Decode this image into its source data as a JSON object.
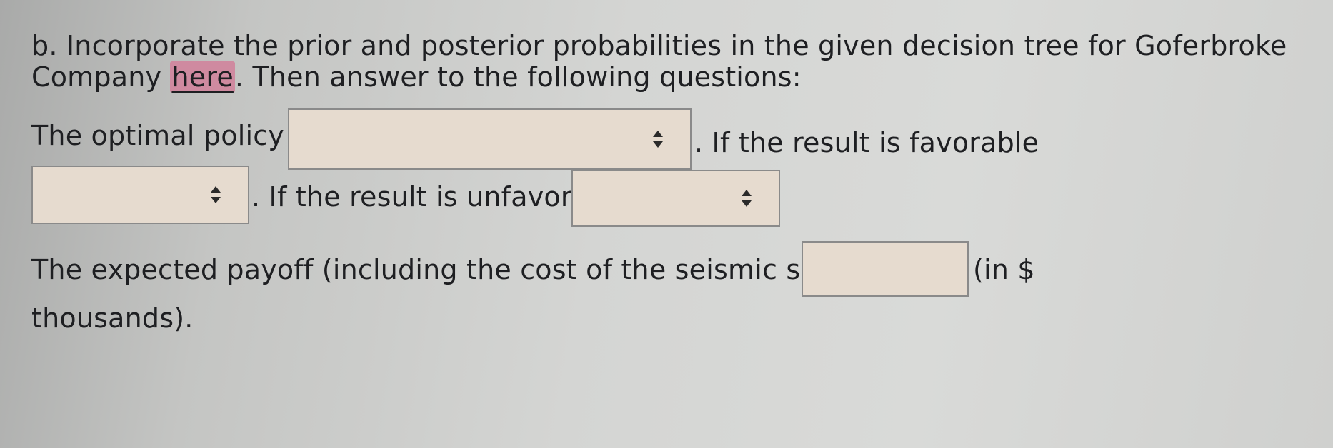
{
  "question": {
    "line1": "b. Incorporate the prior and posterior probabilities in the given decision tree for Goferbroke",
    "line2_before": "Company ",
    "link_text": "here",
    "line2_after": ". Then answer to the following questions:"
  },
  "policy": {
    "prefix": "The optimal policy is",
    "after_select1": ". If the result is favorable",
    "after_select2": ". If the result is unfavorable",
    "select1_value": "",
    "select2_value": "",
    "select3_value": ""
  },
  "payoff": {
    "prefix": "The expected payoff (including the cost of the seismic survey) is",
    "input_value": "",
    "suffix1": "(in $",
    "suffix2": "thousands)."
  }
}
